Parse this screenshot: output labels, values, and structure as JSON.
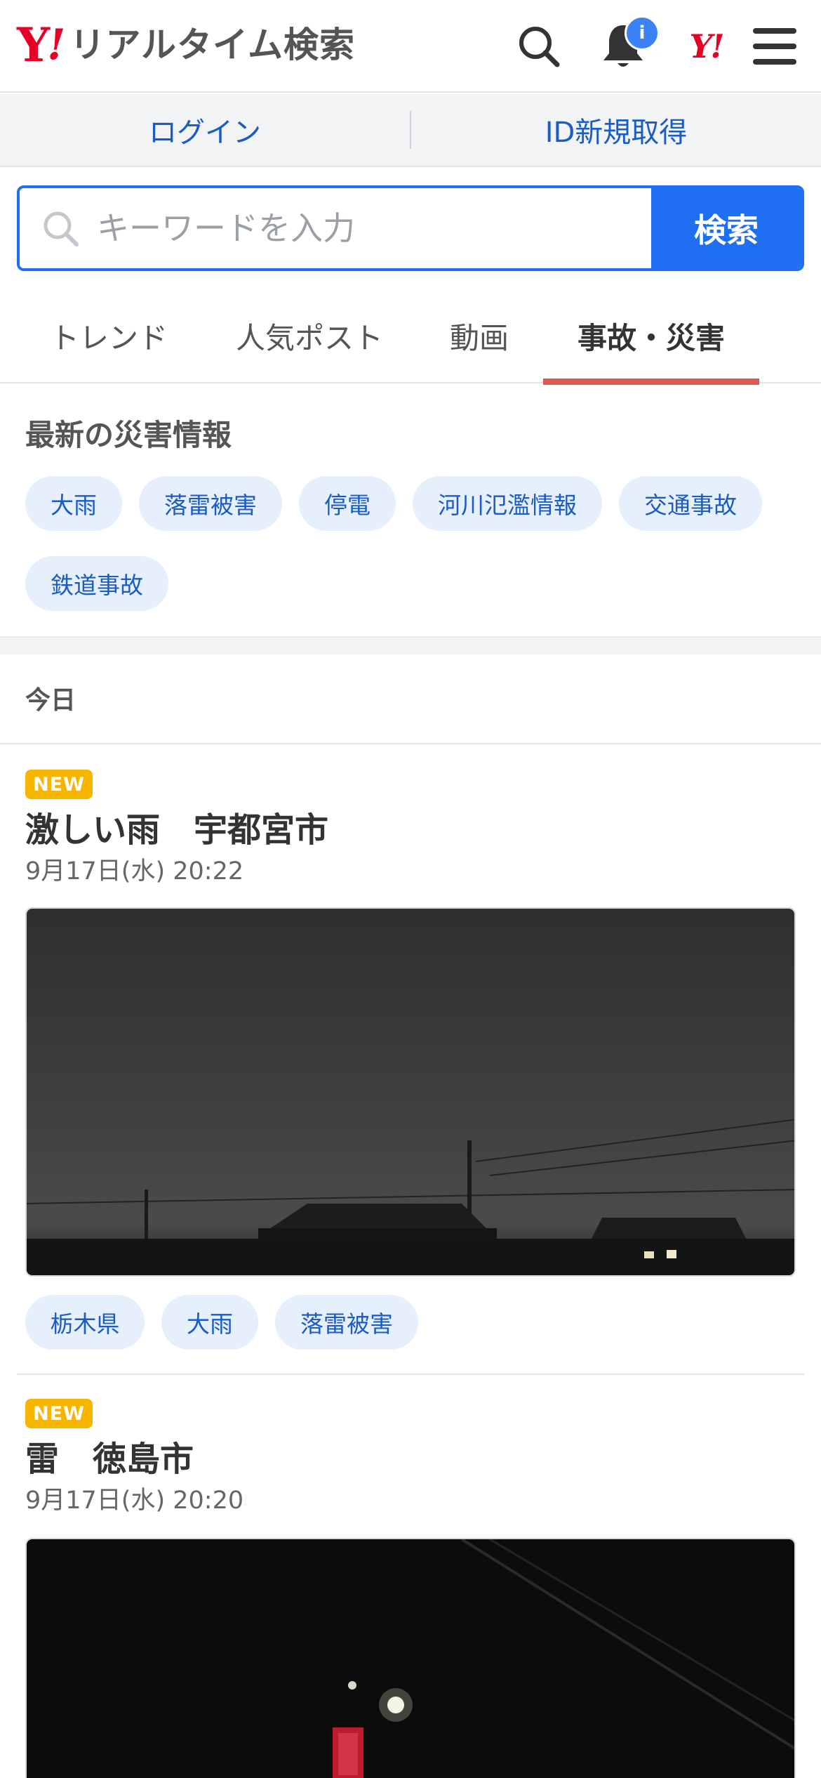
{
  "header": {
    "logo_mark": "Y",
    "logo_excl": "!",
    "logo_text": "リアルタイム検索",
    "notification_badge": "i",
    "yahoo_mini_logo": "Y!"
  },
  "login_bar": {
    "login": "ログイン",
    "register": "ID新規取得"
  },
  "search": {
    "placeholder": "キーワードを入力",
    "button": "検索"
  },
  "tabs": [
    {
      "label": "トレンド"
    },
    {
      "label": "人気ポスト"
    },
    {
      "label": "動画"
    },
    {
      "label": "事故・災害",
      "active": true
    }
  ],
  "disaster": {
    "title": "最新の災害情報",
    "chips": [
      "大雨",
      "落雷被害",
      "停電",
      "河川氾濫情報",
      "交通事故",
      "鉄道事故"
    ]
  },
  "feed": {
    "date_heading": "今日",
    "posts": [
      {
        "badge": "NEW",
        "title": "激しい雨　宇都宮市",
        "date": "9月17日(水) 20:22",
        "tags": [
          "栃木県",
          "大雨",
          "落雷被害"
        ]
      },
      {
        "badge": "NEW",
        "title": "雷　徳島市",
        "date": "9月17日(水) 20:20"
      }
    ]
  },
  "colors": {
    "brand_red": "#e60026",
    "accent_blue": "#1e6ff1",
    "link_blue": "#1a5bc4",
    "active_tab_underline": "#e0584f",
    "new_badge": "#f7b500",
    "chip_bg": "#e6effc"
  },
  "icons": [
    "search-icon",
    "bell-icon",
    "menu-icon"
  ]
}
